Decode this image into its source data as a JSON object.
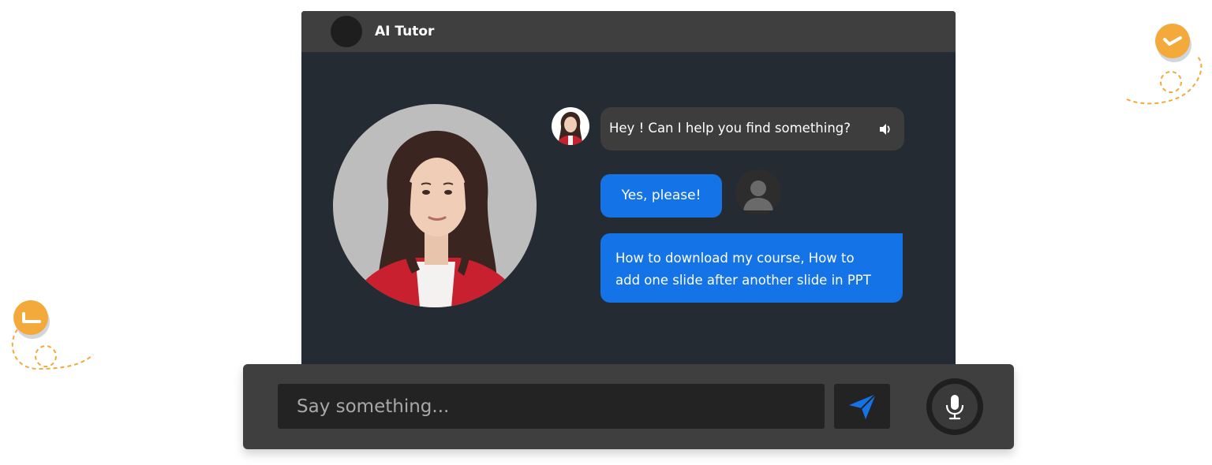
{
  "app": {
    "title": "AI Tutor"
  },
  "chat": {
    "messages": [
      {
        "sender": "bot",
        "text": "Hey ! Can I help you find something?"
      },
      {
        "sender": "user",
        "text": "Yes, please!"
      },
      {
        "sender": "user",
        "lines": [
          "How to download my course, How to",
          "add one slide after another slide in PPT"
        ]
      }
    ]
  },
  "composer": {
    "placeholder": "Say something..."
  },
  "colors": {
    "window_bg": "#252b33",
    "titlebar_bg": "#3f3f3f",
    "user_bubble": "#1473e6",
    "bot_bubble": "#3d3d3d",
    "accent_orange": "#f4a93b",
    "send_icon": "#1473e6"
  },
  "icons": [
    "speaker-icon",
    "send-icon",
    "microphone-icon",
    "user-avatar-icon",
    "check-badge-icon"
  ]
}
